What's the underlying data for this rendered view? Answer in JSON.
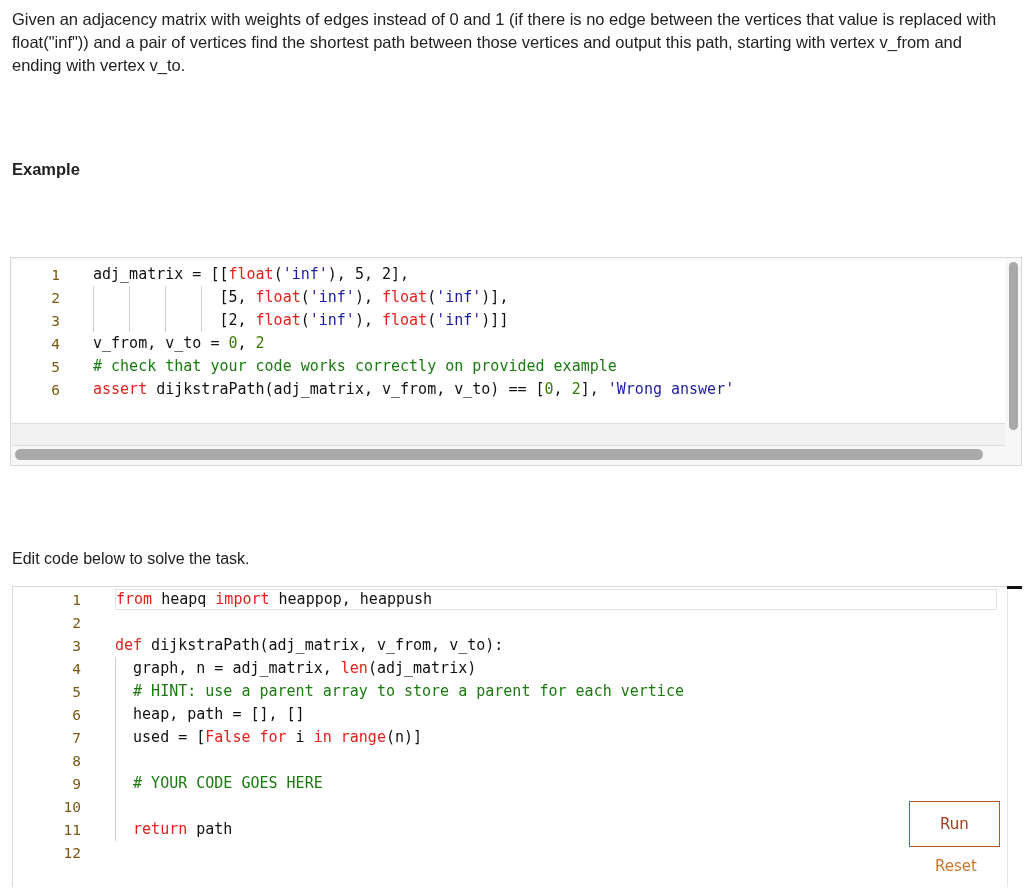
{
  "description": "Given an adjacency matrix with weights of edges instead of 0 and 1 (if there is no edge between the vertices that value is replaced with float(\"inf\")) and a pair of vertices find the shortest path between those vertices and output this path, starting with vertex v_from and ending with vertex v_to.",
  "example": {
    "heading": "Example",
    "editor": {
      "lines": [
        {
          "number": "1",
          "tokens": [
            {
              "kind": "plain",
              "text": "adj_matrix = [["
            },
            {
              "kind": "kw",
              "text": "float"
            },
            {
              "kind": "plain",
              "text": "("
            },
            {
              "kind": "str",
              "text": "'inf'"
            },
            {
              "kind": "plain",
              "text": "), 5, 2],"
            }
          ]
        },
        {
          "number": "2",
          "tokens": [
            {
              "kind": "plain",
              "text": "              [5, "
            },
            {
              "kind": "kw",
              "text": "float"
            },
            {
              "kind": "plain",
              "text": "("
            },
            {
              "kind": "str",
              "text": "'inf'"
            },
            {
              "kind": "plain",
              "text": "), "
            },
            {
              "kind": "kw",
              "text": "float"
            },
            {
              "kind": "plain",
              "text": "("
            },
            {
              "kind": "str",
              "text": "'inf'"
            },
            {
              "kind": "plain",
              "text": ")],"
            }
          ]
        },
        {
          "number": "3",
          "tokens": [
            {
              "kind": "plain",
              "text": "              [2, "
            },
            {
              "kind": "kw",
              "text": "float"
            },
            {
              "kind": "plain",
              "text": "("
            },
            {
              "kind": "str",
              "text": "'inf'"
            },
            {
              "kind": "plain",
              "text": "), "
            },
            {
              "kind": "kw",
              "text": "float"
            },
            {
              "kind": "plain",
              "text": "("
            },
            {
              "kind": "str",
              "text": "'inf'"
            },
            {
              "kind": "plain",
              "text": ")]]"
            }
          ]
        },
        {
          "number": "4",
          "tokens": [
            {
              "kind": "plain",
              "text": "v_from, v_to = "
            },
            {
              "kind": "num",
              "text": "0"
            },
            {
              "kind": "plain",
              "text": ", "
            },
            {
              "kind": "num",
              "text": "2"
            }
          ]
        },
        {
          "number": "5",
          "tokens": [
            {
              "kind": "cmt",
              "text": "# check that your code works correctly on provided example"
            }
          ]
        },
        {
          "number": "6",
          "tokens": [
            {
              "kind": "kw",
              "text": "assert"
            },
            {
              "kind": "plain",
              "text": " dijkstraPath(adj_matrix, v_from, v_to) == ["
            },
            {
              "kind": "num",
              "text": "0"
            },
            {
              "kind": "plain",
              "text": ", "
            },
            {
              "kind": "num",
              "text": "2"
            },
            {
              "kind": "plain",
              "text": "], "
            },
            {
              "kind": "str",
              "text": "'Wrong answer'"
            }
          ]
        }
      ]
    }
  },
  "instruction": "Edit code below to solve the task.",
  "solution": {
    "editor": {
      "lines": [
        {
          "number": "1",
          "active": true,
          "tokens": [
            {
              "kind": "kw",
              "text": "from"
            },
            {
              "kind": "plain",
              "text": " heapq "
            },
            {
              "kind": "kw",
              "text": "import"
            },
            {
              "kind": "plain",
              "text": " heappop, heappush"
            }
          ]
        },
        {
          "number": "2",
          "active": false
        },
        {
          "number": "3",
          "active": false,
          "tokens": [
            {
              "kind": "kw",
              "text": "def"
            },
            {
              "kind": "plain",
              "text": " dijkstraPath(adj_matrix, v_from, v_to):"
            }
          ]
        },
        {
          "number": "4",
          "active": false,
          "tokens": [
            {
              "kind": "plain",
              "text": "  graph, n = adj_matrix, "
            },
            {
              "kind": "kw",
              "text": "len"
            },
            {
              "kind": "plain",
              "text": "(adj_matrix)"
            }
          ]
        },
        {
          "number": "5",
          "active": false,
          "tokens": [
            {
              "kind": "cmt",
              "text": "  # HINT: use a parent array to store a parent for each vertice"
            }
          ]
        },
        {
          "number": "6",
          "active": false,
          "tokens": [
            {
              "kind": "plain",
              "text": "  heap, path = [], []"
            }
          ]
        },
        {
          "number": "7",
          "active": false,
          "tokens": [
            {
              "kind": "plain",
              "text": "  used = ["
            },
            {
              "kind": "kw",
              "text": "False for"
            },
            {
              "kind": "plain",
              "text": " i "
            },
            {
              "kind": "kw",
              "text": "in range"
            },
            {
              "kind": "plain",
              "text": "(n)]"
            }
          ]
        },
        {
          "number": "8",
          "active": false
        },
        {
          "number": "9",
          "active": false,
          "tokens": [
            {
              "kind": "cmt",
              "text": "  # YOUR CODE GOES HERE"
            }
          ]
        },
        {
          "number": "10",
          "active": false
        },
        {
          "number": "11",
          "active": false,
          "tokens": [
            {
              "kind": "kw",
              "text": "  return"
            },
            {
              "kind": "plain",
              "text": " path"
            }
          ]
        },
        {
          "number": "12",
          "active": false
        }
      ]
    },
    "run_button": "Run",
    "reset_link": "Reset"
  }
}
